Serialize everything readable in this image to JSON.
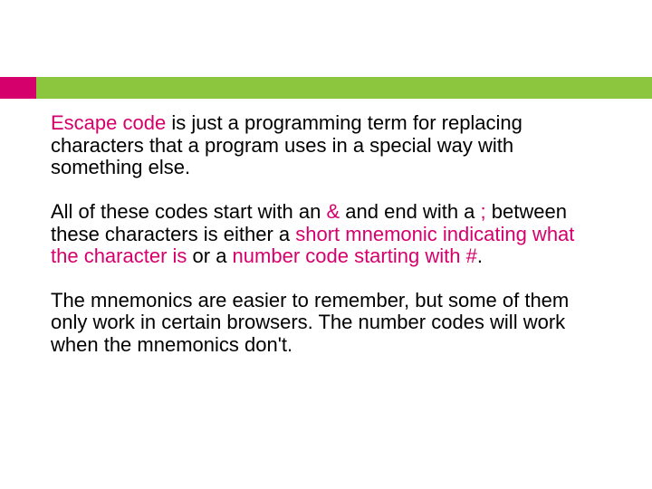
{
  "colors": {
    "accent_green": "#8cc63f",
    "accent_pink": "#d6006c"
  },
  "p1": {
    "t1": "Escape code",
    "t2": " is just a programming term for replacing characters that a program uses in a special way with something else."
  },
  "p2": {
    "t1": "All of these codes start with an ",
    "amp": "&",
    "t2": " and end with a ",
    "semi": ";",
    "t3": " between these characters is either a ",
    "t4": "short mnemonic indicating what the character is",
    "t5": " or a ",
    "t6": "number code starting with #",
    "t7": "."
  },
  "p3": {
    "t1": "The mnemonics are easier to remember, but some of them only work in certain browsers. The number codes will work when the mnemonics don't."
  }
}
